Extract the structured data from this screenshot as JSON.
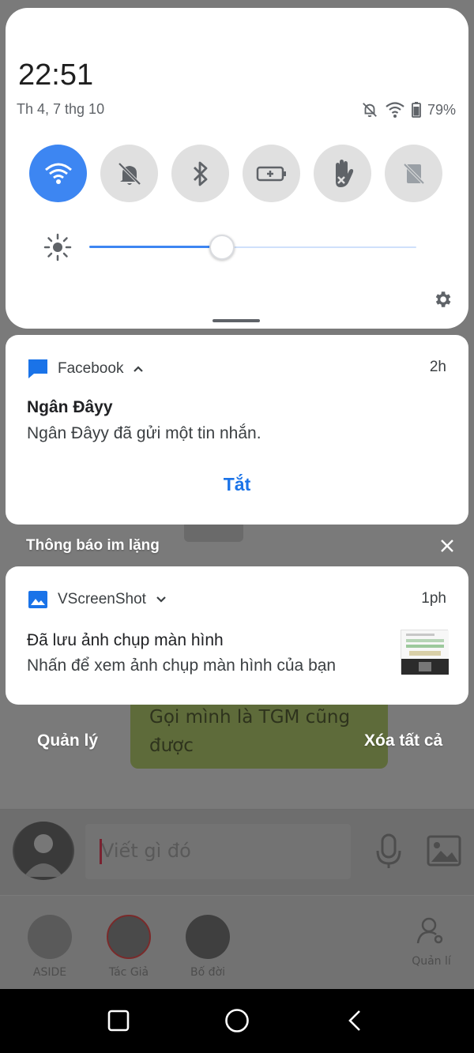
{
  "quick_settings": {
    "time": "22:51",
    "date": "Th 4, 7 thg 10",
    "battery_percent": "79%",
    "brightness_level": 0.4,
    "tiles": [
      {
        "name": "wifi",
        "active": true
      },
      {
        "name": "do-not-disturb",
        "active": false
      },
      {
        "name": "bluetooth",
        "active": false
      },
      {
        "name": "battery-saver",
        "active": false
      },
      {
        "name": "touch-block",
        "active": false
      },
      {
        "name": "auto-rotate",
        "active": false
      }
    ]
  },
  "notifications": {
    "facebook": {
      "app": "Facebook",
      "time": "2h",
      "title": "Ngân Đâyy",
      "body": "Ngân Đâyy đã gửi một tin nhắn.",
      "action": "Tắt"
    },
    "silent_header": "Thông báo im lặng",
    "vscreenshot": {
      "app": "VScreenShot",
      "time": "1ph",
      "title": "Đã lưu ảnh chụp màn hình",
      "body": "Nhấn để xem ảnh chụp màn hình của bạn"
    }
  },
  "footer": {
    "manage": "Quản lý",
    "clear_all": "Xóa tất cả"
  },
  "background_app": {
    "chat_message": "Gọi mình là TGM cũng được",
    "input_placeholder": "Viết gì đó",
    "tabs": [
      "ASIDE",
      "Tác Giả",
      "Bố đời",
      "Quản lí"
    ]
  },
  "colors": {
    "accent": "#3d86f2",
    "action": "#1a73e8"
  }
}
